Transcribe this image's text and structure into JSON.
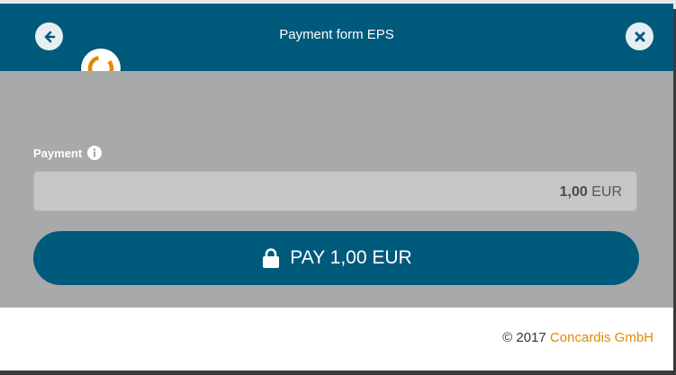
{
  "dialog": {
    "title": "Payment form EPS",
    "back_icon": "arrow-left-icon",
    "close_icon": "close-icon",
    "logo_icon": "concardis-ring-icon"
  },
  "payment": {
    "label": "Payment",
    "info_icon": "info-icon",
    "amount": "1,00",
    "currency": "EUR"
  },
  "pay_button": {
    "icon": "lock-icon",
    "label": "PAY 1,00 EUR"
  },
  "footer": {
    "copyright": "© 2017",
    "brand": "Concardis GmbH"
  },
  "colors": {
    "header": "#005a7c",
    "body": "#a8a9aa",
    "accent": "#e08a00"
  }
}
